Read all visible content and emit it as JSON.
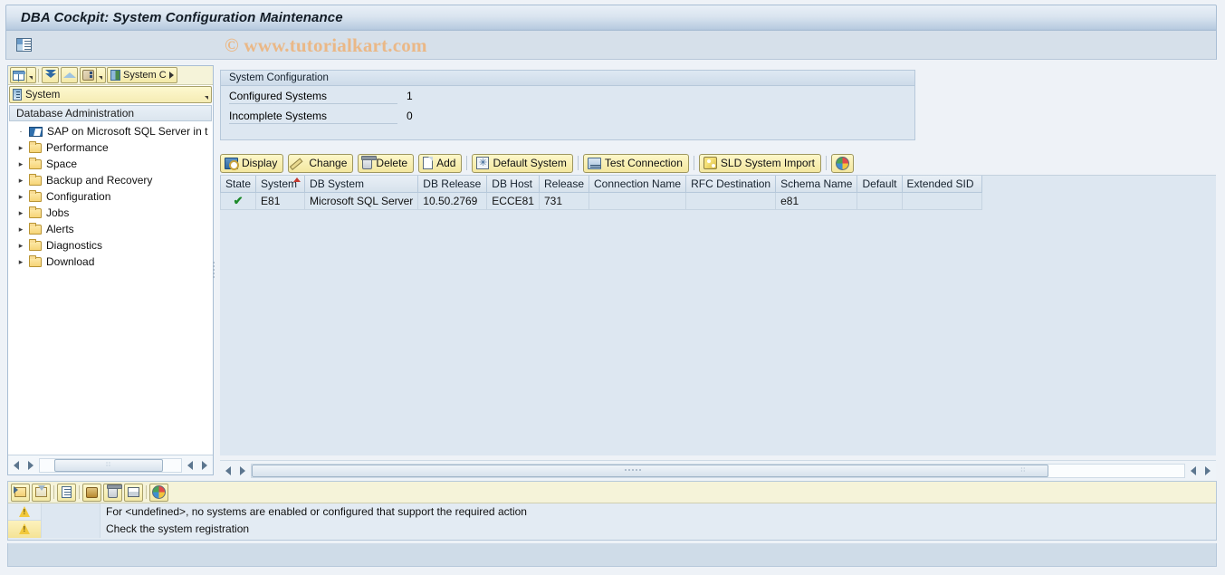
{
  "window": {
    "title": "DBA Cockpit: System Configuration Maintenance",
    "watermark": "© www.tutorialkart.com",
    "subbar_icon": "list-view-icon"
  },
  "sidebar": {
    "toolbar": [
      {
        "name": "table-view-icon",
        "label": ""
      },
      {
        "name": "expand-all-icon",
        "label": ""
      },
      {
        "name": "collapse-all-icon",
        "label": ""
      },
      {
        "name": "settings-icon",
        "label": ""
      }
    ],
    "system_button": {
      "label": "System C",
      "icon": "system-icon"
    },
    "system_dropdown": {
      "label": "System",
      "icon": "system-icon"
    },
    "tree_header": "Database Administration",
    "tree": [
      {
        "label": "SAP on Microsoft SQL Server in t",
        "icon": "database-icon",
        "expander": "dot"
      },
      {
        "label": "Performance",
        "icon": "folder-icon",
        "expander": "arrow"
      },
      {
        "label": "Space",
        "icon": "folder-icon",
        "expander": "arrow"
      },
      {
        "label": "Backup and Recovery",
        "icon": "folder-icon",
        "expander": "arrow"
      },
      {
        "label": "Configuration",
        "icon": "folder-icon",
        "expander": "arrow"
      },
      {
        "label": "Jobs",
        "icon": "folder-icon",
        "expander": "arrow"
      },
      {
        "label": "Alerts",
        "icon": "folder-icon",
        "expander": "arrow"
      },
      {
        "label": "Diagnostics",
        "icon": "folder-icon",
        "expander": "arrow"
      },
      {
        "label": "Download",
        "icon": "folder-icon",
        "expander": "arrow"
      }
    ]
  },
  "system_configuration": {
    "header": "System Configuration",
    "fields": [
      {
        "label": "Configured Systems",
        "value": "1"
      },
      {
        "label": "Incomplete Systems",
        "value": "0"
      }
    ]
  },
  "toolbar": {
    "buttons": [
      {
        "label": "Display",
        "icon": "search-icon"
      },
      {
        "label": "Change",
        "icon": "pencil-icon"
      },
      {
        "label": "Delete",
        "icon": "trash-icon"
      },
      {
        "label": "Add",
        "icon": "page-icon"
      },
      {
        "label": "Default System",
        "icon": "star-icon"
      },
      {
        "label": "Test Connection",
        "icon": "connection-icon"
      },
      {
        "label": "SLD System Import",
        "icon": "wand-icon"
      },
      {
        "label": "",
        "icon": "color-wheel-icon"
      }
    ]
  },
  "table": {
    "columns": [
      "State",
      "System",
      "DB System",
      "DB Release",
      "DB Host",
      "Release",
      "Connection Name",
      "RFC Destination",
      "Schema Name",
      "Default",
      "Extended SID"
    ],
    "sorted_column": "System",
    "rows": [
      {
        "state": "ok-check-icon",
        "System": "E81",
        "DB System": "Microsoft SQL Server",
        "DB Release": "10.50.2769",
        "DB Host": "ECCE81",
        "Release": "731",
        "Connection Name": "",
        "RFC Destination": "",
        "Schema Name": "e81",
        "Default": "",
        "Extended SID": ""
      }
    ]
  },
  "messages": {
    "toolbar": [
      {
        "name": "filter-set-icon"
      },
      {
        "name": "filter-delete-icon"
      },
      {
        "name": "detail-icon"
      },
      {
        "name": "sort-icon"
      },
      {
        "name": "delete-icon"
      },
      {
        "name": "print-icon"
      },
      {
        "name": "color-wheel-icon"
      }
    ],
    "rows": [
      {
        "icon": "warning-icon",
        "highlighted": false,
        "text": "For <undefined>, no systems are enabled or configured that support the required action"
      },
      {
        "icon": "warning-icon",
        "highlighted": true,
        "text": "Check the system registration"
      }
    ]
  },
  "colors": {
    "title_bar": "#dae5f0",
    "panel": "#dde7f1",
    "button": "#f3e79f",
    "accent_blue": "#2f6aa3",
    "warning": "#f2c93c",
    "ok_green": "#1d8a2a",
    "watermark": "#eab887"
  }
}
